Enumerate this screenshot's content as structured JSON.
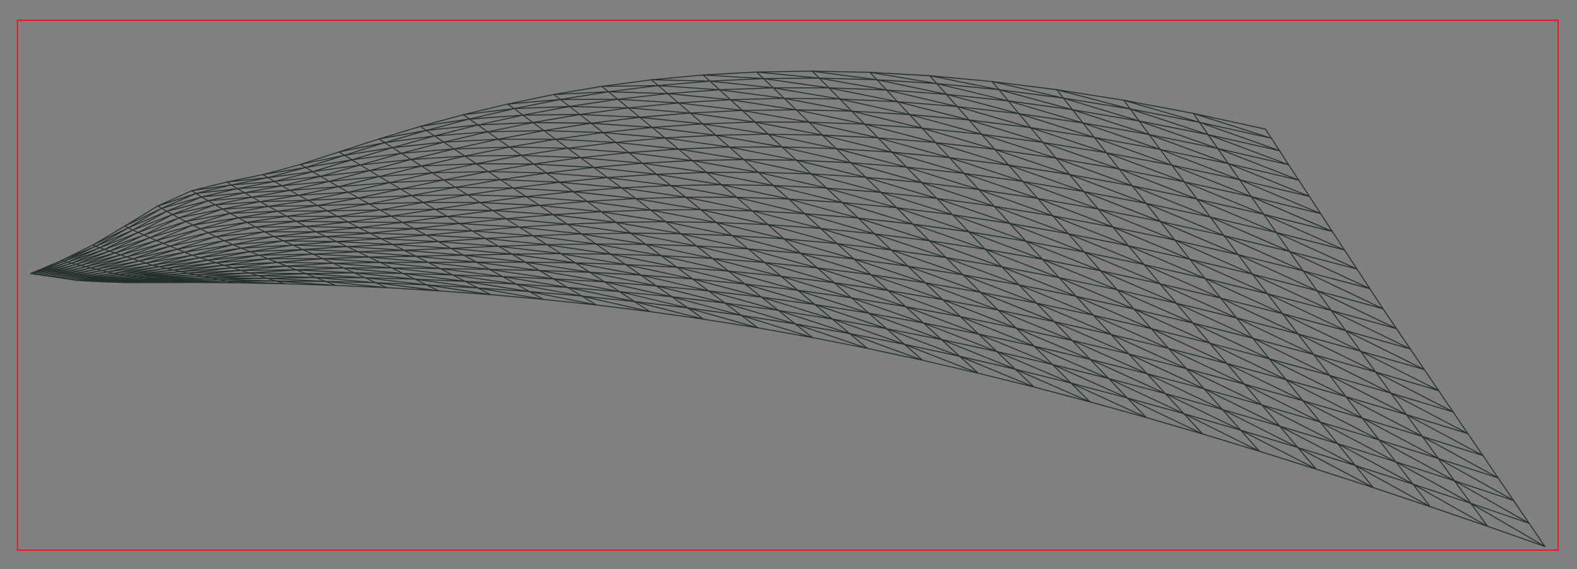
{
  "viewport": {
    "background": "#808080",
    "frame_color": "#e0202a",
    "mesh_color": "#23302a",
    "render_mode": "wireframe",
    "primitive": "triangle-mesh"
  }
}
